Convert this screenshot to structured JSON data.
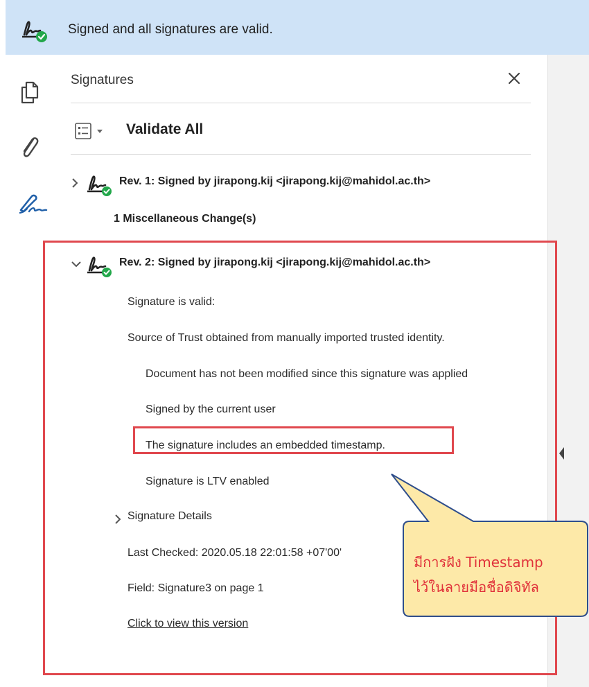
{
  "banner": {
    "text": "Signed and all signatures are valid."
  },
  "leftbar": {
    "items": [
      "pages-icon",
      "attachment-icon",
      "signature-pen-icon"
    ]
  },
  "panel": {
    "title": "Signatures",
    "validate_all": "Validate All",
    "revisions": [
      {
        "label": "Rev. 1: Signed by jirapong.kij <jirapong.kij@mahidol.ac.th>",
        "expanded": false
      },
      {
        "label": "Rev. 2: Signed by jirapong.kij <jirapong.kij@mahidol.ac.th>",
        "expanded": true
      }
    ],
    "misc_change": "1 Miscellaneous Change(s)",
    "details": {
      "valid": "Signature is valid:",
      "trust": "Source of Trust obtained from manually imported trusted identity.",
      "not_modified": "Document has not been modified since this signature was applied",
      "signed_by_user": "Signed by the current user",
      "timestamp": "The signature includes an embedded timestamp.",
      "ltv": "Signature is LTV enabled",
      "signature_details": "Signature Details",
      "last_checked": "Last Checked: 2020.05.18 22:01:58 +07'00'",
      "field": "Field: Signature3 on page 1",
      "view_version": "Click to view this version"
    }
  },
  "callout": {
    "line1": "มีการฝัง Timestamp",
    "line2": "ไว้ในลายมือชื่อดิจิทัล"
  },
  "colors": {
    "banner_bg": "#cfe3f7",
    "highlight_red": "#e0484e",
    "callout_fill": "#fde9a8",
    "callout_border": "#2f4e8c",
    "callout_text": "#e0313a",
    "valid_green": "#22a74a"
  }
}
